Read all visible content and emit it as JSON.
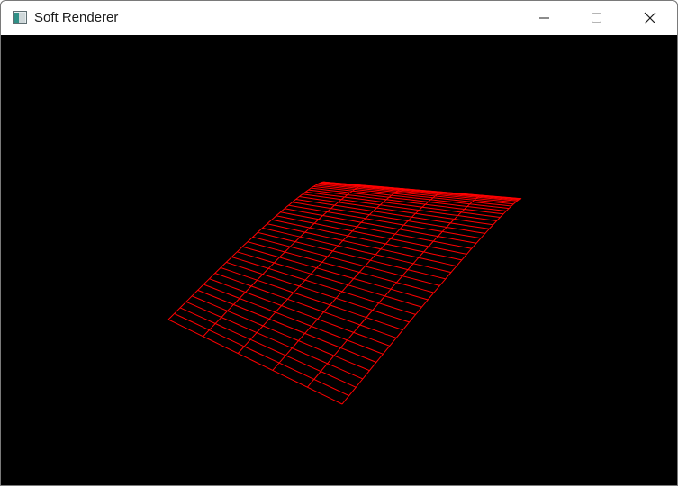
{
  "window": {
    "title": "Soft Renderer",
    "app_icon": "window-app-icon",
    "controls": {
      "minimize_icon": "minimize-icon",
      "maximize_icon": "maximize-icon",
      "close_icon": "close-icon"
    }
  },
  "viewport": {
    "background_color": "#000000",
    "mesh_color": "#ff0000",
    "render_mode": "wireframe"
  }
}
